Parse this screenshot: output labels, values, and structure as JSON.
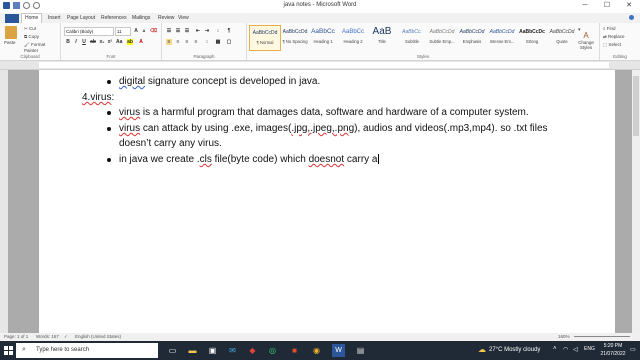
{
  "window": {
    "title": "java notes - Microsoft Word",
    "controls": [
      "minimize",
      "maximize",
      "close"
    ]
  },
  "tabs": [
    "Home",
    "Insert",
    "Page Layout",
    "References",
    "Mailings",
    "Review",
    "View"
  ],
  "ribbon": {
    "clipboard": {
      "paste": "Paste",
      "cut": "Cut",
      "copy": "Copy",
      "format_painter": "Format Painter",
      "label": "Clipboard"
    },
    "font": {
      "name": "Calibri (Body)",
      "size": "11",
      "label": "Font"
    },
    "paragraph": {
      "label": "Paragraph"
    },
    "styles": {
      "label": "Styles",
      "items": [
        {
          "preview": "AaBbCcDd",
          "name": "¶ Normal"
        },
        {
          "preview": "AaBbCcDd",
          "name": "¶ No Spacing"
        },
        {
          "preview": "AaBbCc",
          "name": "Heading 1"
        },
        {
          "preview": "AaBbCc",
          "name": "Heading 2"
        },
        {
          "preview": "AaB",
          "name": "Title"
        },
        {
          "preview": "AaBbCc.",
          "name": "Subtitle"
        },
        {
          "preview": "AaBbCcDd",
          "name": "Subtle Emp..."
        },
        {
          "preview": "AaBbCcDd",
          "name": "Emphasis"
        },
        {
          "preview": "AaBbCcDd",
          "name": "Intense Em..."
        },
        {
          "preview": "AaBbCcDc",
          "name": "Strong"
        },
        {
          "preview": "AaBbCcDd",
          "name": "Quote"
        }
      ],
      "change_styles": "Change Styles"
    },
    "editing": {
      "find": "Find",
      "replace": "Replace",
      "select": "Select",
      "label": "Editing"
    }
  },
  "document": {
    "line1_word": "digital",
    "line1_rest": " signature concept is developed in java.",
    "heading": "4.virus",
    "heading_colon": ":",
    "b1_word": "virus",
    "b1_rest": " is a harmful program that damages data, software and hardware of a computer system.",
    "b2_word": "virus",
    "b2_rest": " can attack by using .exe, images(",
    "b2_sq": ".jpg,.jpeg,.png",
    "b2_rest2": "), audios and videos(.mp3,mp4). so .txt files",
    "b2_cont": "doesn’t carry any virus.",
    "b3_a": "in java we create .",
    "b3_sq1": "cls",
    "b3_b": " file(byte code) which ",
    "b3_sq2": "doesnot",
    "b3_c": " carry a"
  },
  "status": {
    "page": "Page: 1 of 1",
    "words": "Words: 167",
    "language": "English (United States)",
    "zoom": "160%"
  },
  "taskbar": {
    "search_placeholder": "Type here to search",
    "weather": "27°C  Mostly cloudy",
    "time": "5:20 PM",
    "date": "21/07/2022"
  }
}
